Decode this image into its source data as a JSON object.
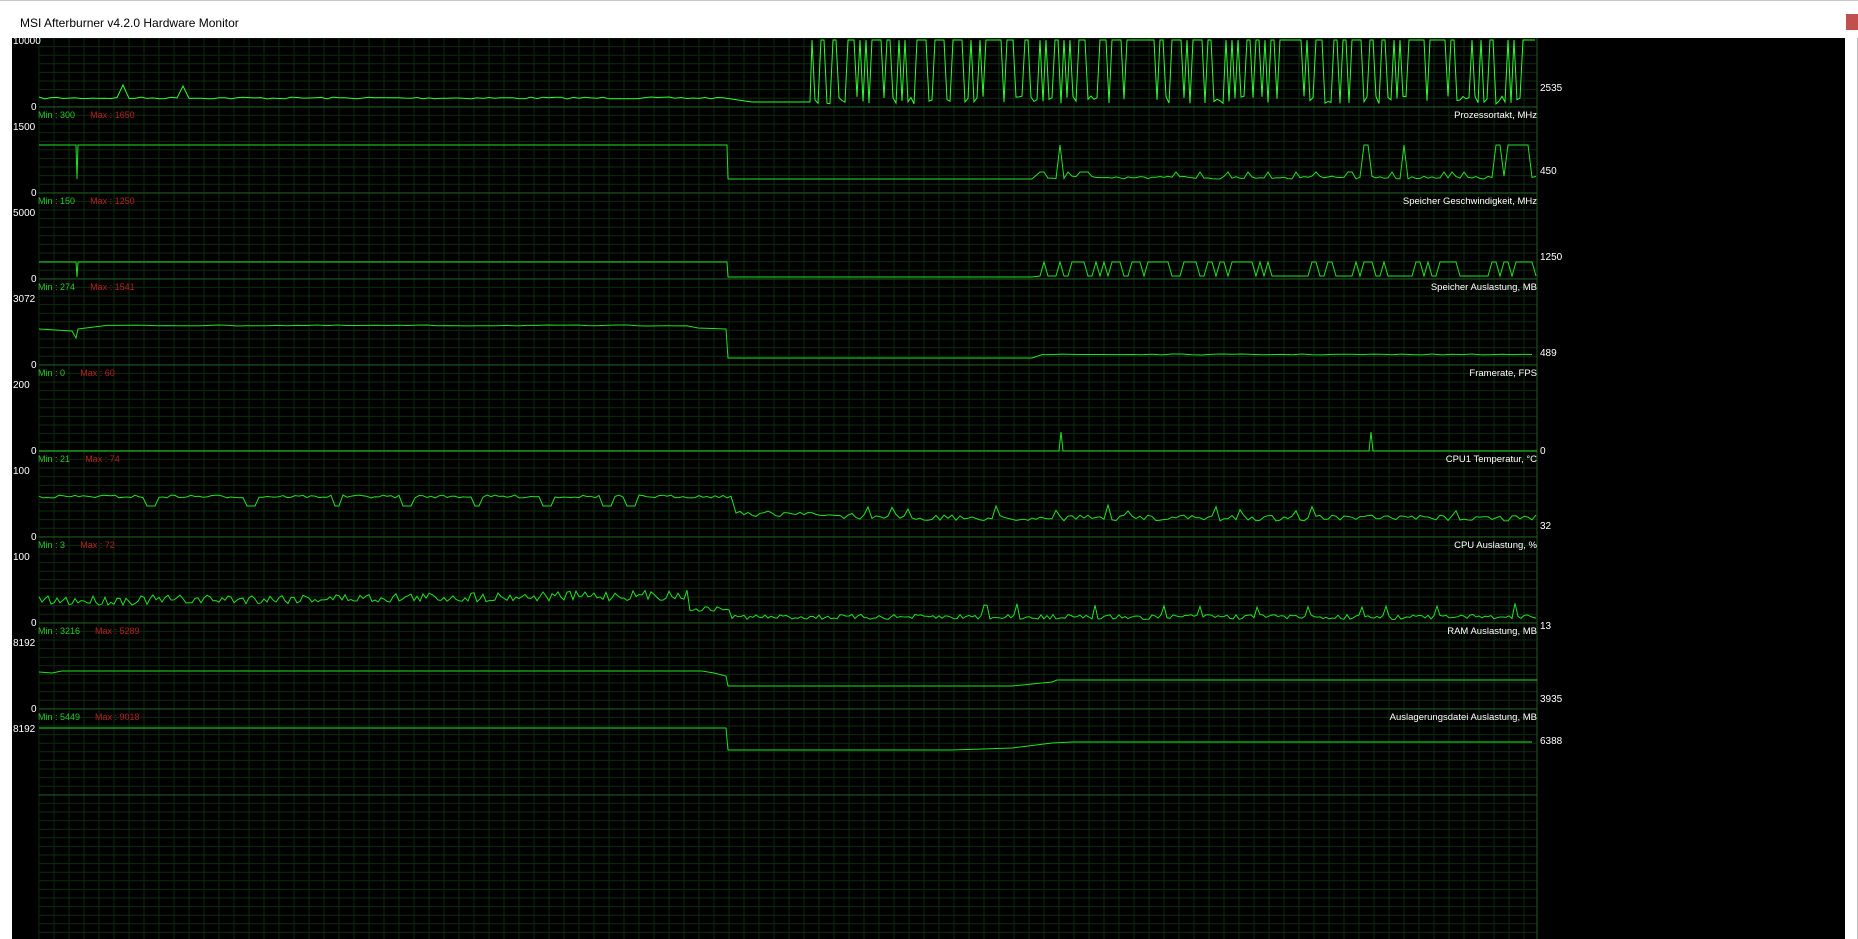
{
  "window": {
    "title": "MSI Afterburner v4.2.0 Hardware Monitor"
  },
  "colors": {
    "background": "#000000",
    "grid": "#0c2b0c",
    "separator": "#1e5a1e",
    "trace": "#1fe31f",
    "trace_bright": "#2cff2c",
    "min_text": "#24c824",
    "max_text": "#b81e1e",
    "label_text": "#ffffff"
  },
  "graphs": [
    {
      "id": "core_clock",
      "name": "Prozessortakt, MHz",
      "top_label": "10000",
      "bottom_label": "0",
      "current": "2535",
      "min_text": "",
      "max_text": ""
    },
    {
      "id": "mem_clock",
      "name": "Speicher Geschwindigkeit, MHz",
      "top_label": "1500",
      "bottom_label": "0",
      "current": "450",
      "min_text": "Min : 300",
      "max_text": "Max : 1650"
    },
    {
      "id": "mem_usage",
      "name": "Speicher Auslastung, MB",
      "top_label": "5000",
      "bottom_label": "0",
      "current": "1250",
      "min_text": "Min : 150",
      "max_text": "Max : 1250"
    },
    {
      "id": "framerate",
      "name": "Framerate, FPS",
      "top_label": "3072",
      "bottom_label": "0",
      "current": "489",
      "min_text": "Min : 274",
      "max_text": "Max : 1541"
    },
    {
      "id": "cpu1_temp",
      "name": "CPU1 Temperatur, °C",
      "top_label": "200",
      "bottom_label": "0",
      "current": "0",
      "min_text": "Min : 0",
      "max_text": "Max : 60"
    },
    {
      "id": "cpu_usage",
      "name": "CPU Auslastung, %",
      "top_label": "100",
      "bottom_label": "0",
      "current": "32",
      "min_text": "Min : 21",
      "max_text": "Max : 74"
    },
    {
      "id": "ram_usage",
      "name": "RAM Auslastung, MB",
      "top_label": "100",
      "bottom_label": "0",
      "current": "13",
      "min_text": "Min : 3",
      "max_text": "Max : 72"
    },
    {
      "id": "pagefile_usage",
      "name": "Auslagerungsdatei Auslastung, MB",
      "top_label": "8192",
      "bottom_label": "0",
      "current": "3935",
      "min_text": "Min : 3216",
      "max_text": "Max : 5289"
    },
    {
      "id": "extra",
      "name": "",
      "top_label": "8192",
      "bottom_label": "",
      "current": "6388",
      "min_text": "Min : 5449",
      "max_text": "Max : 9018"
    }
  ]
}
